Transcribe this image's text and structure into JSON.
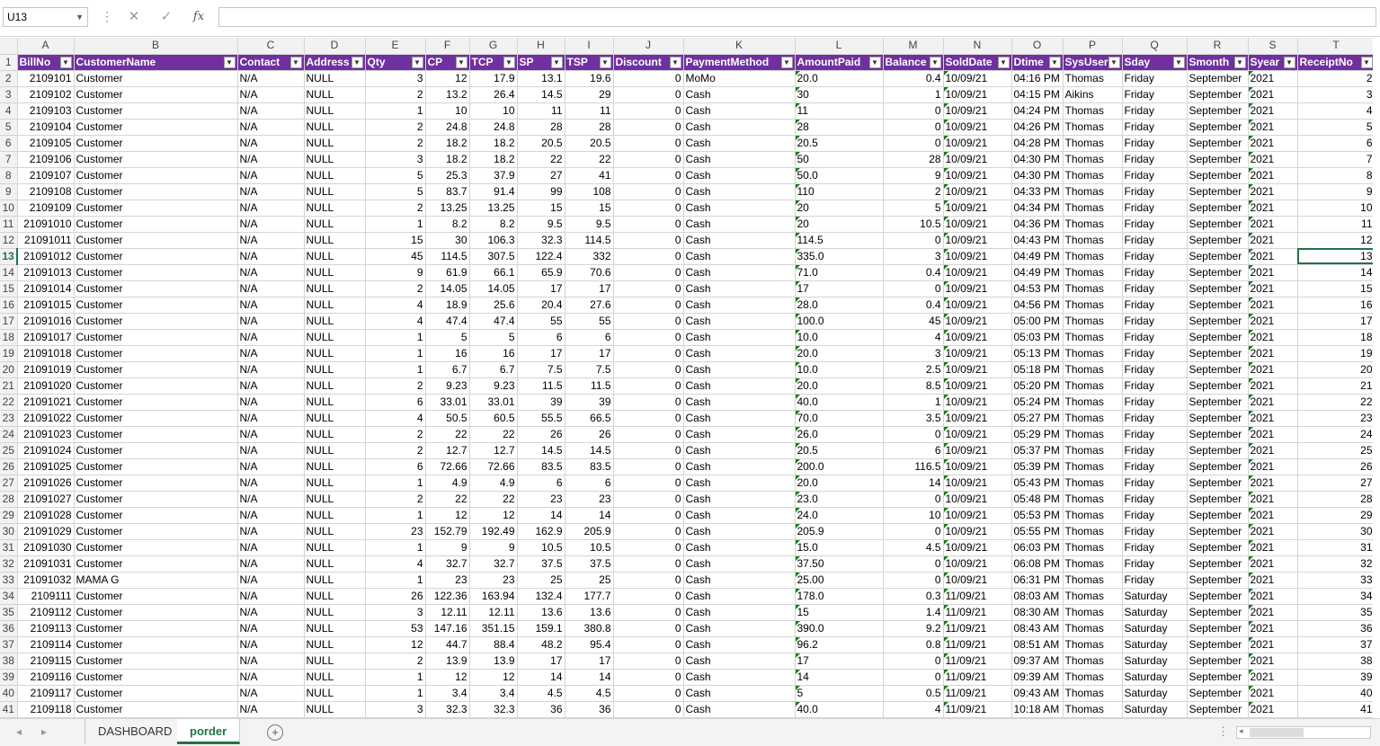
{
  "formula_bar": {
    "name_box": "U13",
    "formula": "",
    "fx_label": "fx",
    "cancel_icon": "close-icon",
    "enter_icon": "check-icon"
  },
  "columns": [
    "A",
    "B",
    "C",
    "D",
    "E",
    "F",
    "G",
    "H",
    "I",
    "J",
    "K",
    "L",
    "M",
    "N",
    "O",
    "P",
    "Q",
    "R",
    "S",
    "T"
  ],
  "headers": [
    "BillNo",
    "CustomerName",
    "Contact",
    "Address",
    "Qty",
    "CP",
    "TCP",
    "SP",
    "TSP",
    "Discount",
    "PaymentMethod",
    "AmountPaid",
    "Balance",
    "SoldDate",
    "Dtime",
    "SysUser",
    "Sday",
    "Smonth",
    "Syear",
    "ReceiptNo"
  ],
  "rows": [
    [
      "2109101",
      "Customer",
      "N/A",
      "NULL",
      "3",
      "12",
      "17.9",
      "13.1",
      "19.6",
      "0",
      "MoMo",
      "20.0",
      "0.4",
      "10/09/21",
      "04:16 PM",
      "Thomas",
      "Friday",
      "September",
      "2021",
      "2"
    ],
    [
      "2109102",
      "Customer",
      "N/A",
      "NULL",
      "2",
      "13.2",
      "26.4",
      "14.5",
      "29",
      "0",
      "Cash",
      "30",
      "1",
      "10/09/21",
      "04:15 PM",
      "Aikins",
      "Friday",
      "September",
      "2021",
      "3"
    ],
    [
      "2109103",
      "Customer",
      "N/A",
      "NULL",
      "1",
      "10",
      "10",
      "11",
      "11",
      "0",
      "Cash",
      "11",
      "0",
      "10/09/21",
      "04:24 PM",
      "Thomas",
      "Friday",
      "September",
      "2021",
      "4"
    ],
    [
      "2109104",
      "Customer",
      "N/A",
      "NULL",
      "2",
      "24.8",
      "24.8",
      "28",
      "28",
      "0",
      "Cash",
      "28",
      "0",
      "10/09/21",
      "04:26 PM",
      "Thomas",
      "Friday",
      "September",
      "2021",
      "5"
    ],
    [
      "2109105",
      "Customer",
      "N/A",
      "NULL",
      "2",
      "18.2",
      "18.2",
      "20.5",
      "20.5",
      "0",
      "Cash",
      "20.5",
      "0",
      "10/09/21",
      "04:28 PM",
      "Thomas",
      "Friday",
      "September",
      "2021",
      "6"
    ],
    [
      "2109106",
      "Customer",
      "N/A",
      "NULL",
      "3",
      "18.2",
      "18.2",
      "22",
      "22",
      "0",
      "Cash",
      "50",
      "28",
      "10/09/21",
      "04:30 PM",
      "Thomas",
      "Friday",
      "September",
      "2021",
      "7"
    ],
    [
      "2109107",
      "Customer",
      "N/A",
      "NULL",
      "5",
      "25.3",
      "37.9",
      "27",
      "41",
      "0",
      "Cash",
      "50.0",
      "9",
      "10/09/21",
      "04:30 PM",
      "Thomas",
      "Friday",
      "September",
      "2021",
      "8"
    ],
    [
      "2109108",
      "Customer",
      "N/A",
      "NULL",
      "5",
      "83.7",
      "91.4",
      "99",
      "108",
      "0",
      "Cash",
      "110",
      "2",
      "10/09/21",
      "04:33 PM",
      "Thomas",
      "Friday",
      "September",
      "2021",
      "9"
    ],
    [
      "2109109",
      "Customer",
      "N/A",
      "NULL",
      "2",
      "13.25",
      "13.25",
      "15",
      "15",
      "0",
      "Cash",
      "20",
      "5",
      "10/09/21",
      "04:34 PM",
      "Thomas",
      "Friday",
      "September",
      "2021",
      "10"
    ],
    [
      "21091010",
      "Customer",
      "N/A",
      "NULL",
      "1",
      "8.2",
      "8.2",
      "9.5",
      "9.5",
      "0",
      "Cash",
      "20",
      "10.5",
      "10/09/21",
      "04:36 PM",
      "Thomas",
      "Friday",
      "September",
      "2021",
      "11"
    ],
    [
      "21091011",
      "Customer",
      "N/A",
      "NULL",
      "15",
      "30",
      "106.3",
      "32.3",
      "114.5",
      "0",
      "Cash",
      "114.5",
      "0",
      "10/09/21",
      "04:43 PM",
      "Thomas",
      "Friday",
      "September",
      "2021",
      "12"
    ],
    [
      "21091012",
      "Customer",
      "N/A",
      "NULL",
      "45",
      "114.5",
      "307.5",
      "122.4",
      "332",
      "0",
      "Cash",
      "335.0",
      "3",
      "10/09/21",
      "04:49 PM",
      "Thomas",
      "Friday",
      "September",
      "2021",
      "13"
    ],
    [
      "21091013",
      "Customer",
      "N/A",
      "NULL",
      "9",
      "61.9",
      "66.1",
      "65.9",
      "70.6",
      "0",
      "Cash",
      "71.0",
      "0.4",
      "10/09/21",
      "04:49 PM",
      "Thomas",
      "Friday",
      "September",
      "2021",
      "14"
    ],
    [
      "21091014",
      "Customer",
      "N/A",
      "NULL",
      "2",
      "14.05",
      "14.05",
      "17",
      "17",
      "0",
      "Cash",
      "17",
      "0",
      "10/09/21",
      "04:53 PM",
      "Thomas",
      "Friday",
      "September",
      "2021",
      "15"
    ],
    [
      "21091015",
      "Customer",
      "N/A",
      "NULL",
      "4",
      "18.9",
      "25.6",
      "20.4",
      "27.6",
      "0",
      "Cash",
      "28.0",
      "0.4",
      "10/09/21",
      "04:56 PM",
      "Thomas",
      "Friday",
      "September",
      "2021",
      "16"
    ],
    [
      "21091016",
      "Customer",
      "N/A",
      "NULL",
      "4",
      "47.4",
      "47.4",
      "55",
      "55",
      "0",
      "Cash",
      "100.0",
      "45",
      "10/09/21",
      "05:00 PM",
      "Thomas",
      "Friday",
      "September",
      "2021",
      "17"
    ],
    [
      "21091017",
      "Customer",
      "N/A",
      "NULL",
      "1",
      "5",
      "5",
      "6",
      "6",
      "0",
      "Cash",
      "10.0",
      "4",
      "10/09/21",
      "05:03 PM",
      "Thomas",
      "Friday",
      "September",
      "2021",
      "18"
    ],
    [
      "21091018",
      "Customer",
      "N/A",
      "NULL",
      "1",
      "16",
      "16",
      "17",
      "17",
      "0",
      "Cash",
      "20.0",
      "3",
      "10/09/21",
      "05:13 PM",
      "Thomas",
      "Friday",
      "September",
      "2021",
      "19"
    ],
    [
      "21091019",
      "Customer",
      "N/A",
      "NULL",
      "1",
      "6.7",
      "6.7",
      "7.5",
      "7.5",
      "0",
      "Cash",
      "10.0",
      "2.5",
      "10/09/21",
      "05:18 PM",
      "Thomas",
      "Friday",
      "September",
      "2021",
      "20"
    ],
    [
      "21091020",
      "Customer",
      "N/A",
      "NULL",
      "2",
      "9.23",
      "9.23",
      "11.5",
      "11.5",
      "0",
      "Cash",
      "20.0",
      "8.5",
      "10/09/21",
      "05:20 PM",
      "Thomas",
      "Friday",
      "September",
      "2021",
      "21"
    ],
    [
      "21091021",
      "Customer",
      "N/A",
      "NULL",
      "6",
      "33.01",
      "33.01",
      "39",
      "39",
      "0",
      "Cash",
      "40.0",
      "1",
      "10/09/21",
      "05:24 PM",
      "Thomas",
      "Friday",
      "September",
      "2021",
      "22"
    ],
    [
      "21091022",
      "Customer",
      "N/A",
      "NULL",
      "4",
      "50.5",
      "60.5",
      "55.5",
      "66.5",
      "0",
      "Cash",
      "70.0",
      "3.5",
      "10/09/21",
      "05:27 PM",
      "Thomas",
      "Friday",
      "September",
      "2021",
      "23"
    ],
    [
      "21091023",
      "Customer",
      "N/A",
      "NULL",
      "2",
      "22",
      "22",
      "26",
      "26",
      "0",
      "Cash",
      "26.0",
      "0",
      "10/09/21",
      "05:29 PM",
      "Thomas",
      "Friday",
      "September",
      "2021",
      "24"
    ],
    [
      "21091024",
      "Customer",
      "N/A",
      "NULL",
      "2",
      "12.7",
      "12.7",
      "14.5",
      "14.5",
      "0",
      "Cash",
      "20.5",
      "6",
      "10/09/21",
      "05:37 PM",
      "Thomas",
      "Friday",
      "September",
      "2021",
      "25"
    ],
    [
      "21091025",
      "Customer",
      "N/A",
      "NULL",
      "6",
      "72.66",
      "72.66",
      "83.5",
      "83.5",
      "0",
      "Cash",
      "200.0",
      "116.5",
      "10/09/21",
      "05:39 PM",
      "Thomas",
      "Friday",
      "September",
      "2021",
      "26"
    ],
    [
      "21091026",
      "Customer",
      "N/A",
      "NULL",
      "1",
      "4.9",
      "4.9",
      "6",
      "6",
      "0",
      "Cash",
      "20.0",
      "14",
      "10/09/21",
      "05:43 PM",
      "Thomas",
      "Friday",
      "September",
      "2021",
      "27"
    ],
    [
      "21091027",
      "Customer",
      "N/A",
      "NULL",
      "2",
      "22",
      "22",
      "23",
      "23",
      "0",
      "Cash",
      "23.0",
      "0",
      "10/09/21",
      "05:48 PM",
      "Thomas",
      "Friday",
      "September",
      "2021",
      "28"
    ],
    [
      "21091028",
      "Customer",
      "N/A",
      "NULL",
      "1",
      "12",
      "12",
      "14",
      "14",
      "0",
      "Cash",
      "24.0",
      "10",
      "10/09/21",
      "05:53 PM",
      "Thomas",
      "Friday",
      "September",
      "2021",
      "29"
    ],
    [
      "21091029",
      "Customer",
      "N/A",
      "NULL",
      "23",
      "152.79",
      "192.49",
      "162.9",
      "205.9",
      "0",
      "Cash",
      "205.9",
      "0",
      "10/09/21",
      "05:55 PM",
      "Thomas",
      "Friday",
      "September",
      "2021",
      "30"
    ],
    [
      "21091030",
      "Customer",
      "N/A",
      "NULL",
      "1",
      "9",
      "9",
      "10.5",
      "10.5",
      "0",
      "Cash",
      "15.0",
      "4.5",
      "10/09/21",
      "06:03 PM",
      "Thomas",
      "Friday",
      "September",
      "2021",
      "31"
    ],
    [
      "21091031",
      "Customer",
      "N/A",
      "NULL",
      "4",
      "32.7",
      "32.7",
      "37.5",
      "37.5",
      "0",
      "Cash",
      "37.50",
      "0",
      "10/09/21",
      "06:08 PM",
      "Thomas",
      "Friday",
      "September",
      "2021",
      "32"
    ],
    [
      "21091032",
      "MAMA G",
      "N/A",
      "NULL",
      "1",
      "23",
      "23",
      "25",
      "25",
      "0",
      "Cash",
      "25.00",
      "0",
      "10/09/21",
      "06:31 PM",
      "Thomas",
      "Friday",
      "September",
      "2021",
      "33"
    ],
    [
      "2109111",
      "Customer",
      "N/A",
      "NULL",
      "26",
      "122.36",
      "163.94",
      "132.4",
      "177.7",
      "0",
      "Cash",
      "178.0",
      "0.3",
      "11/09/21",
      "08:03 AM",
      "Thomas",
      "Saturday",
      "September",
      "2021",
      "34"
    ],
    [
      "2109112",
      "Customer",
      "N/A",
      "NULL",
      "3",
      "12.11",
      "12.11",
      "13.6",
      "13.6",
      "0",
      "Cash",
      "15",
      "1.4",
      "11/09/21",
      "08:30 AM",
      "Thomas",
      "Saturday",
      "September",
      "2021",
      "35"
    ],
    [
      "2109113",
      "Customer",
      "N/A",
      "NULL",
      "53",
      "147.16",
      "351.15",
      "159.1",
      "380.8",
      "0",
      "Cash",
      "390.0",
      "9.2",
      "11/09/21",
      "08:43 AM",
      "Thomas",
      "Saturday",
      "September",
      "2021",
      "36"
    ],
    [
      "2109114",
      "Customer",
      "N/A",
      "NULL",
      "12",
      "44.7",
      "88.4",
      "48.2",
      "95.4",
      "0",
      "Cash",
      "96.2",
      "0.8",
      "11/09/21",
      "08:51 AM",
      "Thomas",
      "Saturday",
      "September",
      "2021",
      "37"
    ],
    [
      "2109115",
      "Customer",
      "N/A",
      "NULL",
      "2",
      "13.9",
      "13.9",
      "17",
      "17",
      "0",
      "Cash",
      "17",
      "0",
      "11/09/21",
      "09:37 AM",
      "Thomas",
      "Saturday",
      "September",
      "2021",
      "38"
    ],
    [
      "2109116",
      "Customer",
      "N/A",
      "NULL",
      "1",
      "12",
      "12",
      "14",
      "14",
      "0",
      "Cash",
      "14",
      "0",
      "11/09/21",
      "09:39 AM",
      "Thomas",
      "Saturday",
      "September",
      "2021",
      "39"
    ],
    [
      "2109117",
      "Customer",
      "N/A",
      "NULL",
      "1",
      "3.4",
      "3.4",
      "4.5",
      "4.5",
      "0",
      "Cash",
      "5",
      "0.5",
      "11/09/21",
      "09:43 AM",
      "Thomas",
      "Saturday",
      "September",
      "2021",
      "40"
    ],
    [
      "2109118",
      "Customer",
      "N/A",
      "NULL",
      "3",
      "32.3",
      "32.3",
      "36",
      "36",
      "0",
      "Cash",
      "40.0",
      "4",
      "11/09/21",
      "10:18 AM",
      "Thomas",
      "Saturday",
      "September",
      "2021",
      "41"
    ]
  ],
  "sheet_tabs": [
    "DASHBOARD",
    "porder"
  ],
  "active_tab": "porder",
  "active_row": 13,
  "accent_color": "#217346",
  "header_color": "#7030a0"
}
